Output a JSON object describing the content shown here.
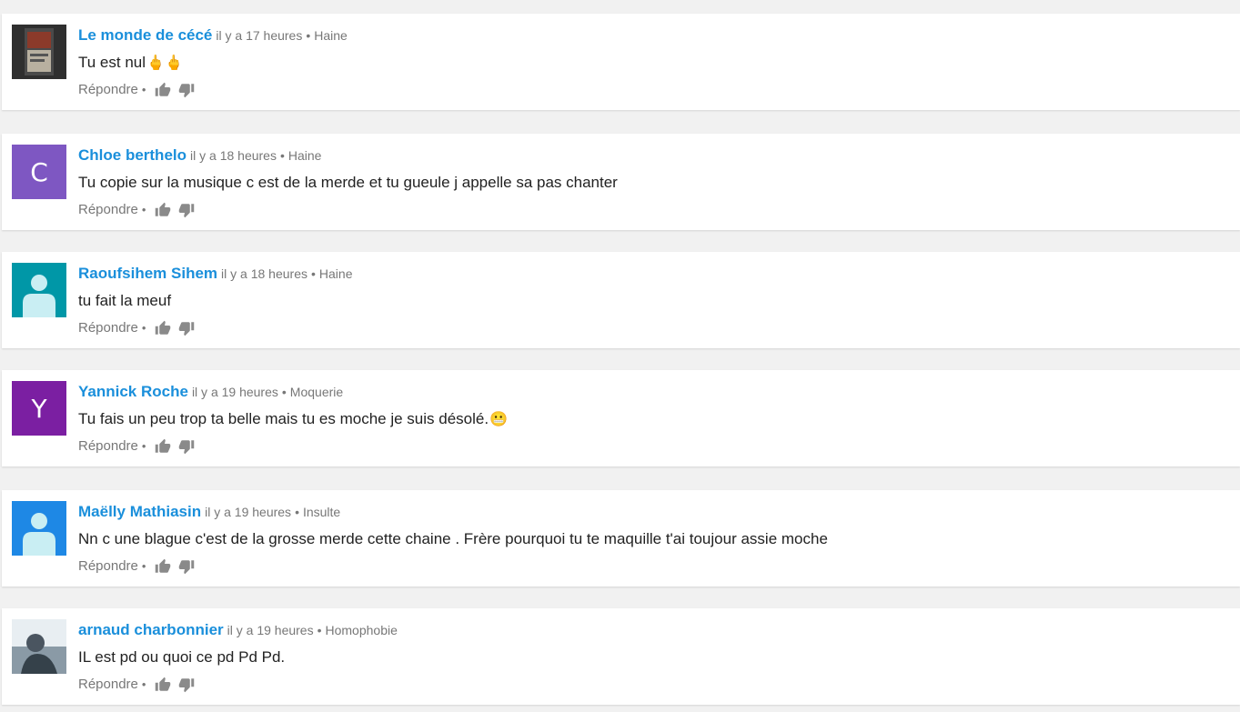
{
  "theme": {
    "author_color": "#1a8fdb",
    "meta_color": "#777777",
    "background": "#f1f1f1"
  },
  "comments": [
    {
      "author": "Le monde de cécé",
      "time": "il y a 17 heures",
      "category": "Haine",
      "text": "Tu est nul",
      "emoji": "🖕🖕",
      "reply": "Répondre",
      "avatar": {
        "type": "photo",
        "color": "#4a4a4a"
      }
    },
    {
      "author": "Chloe berthelo",
      "time": "il y a 18 heures",
      "category": "Haine",
      "text": "Tu copie sur la musique c est de la merde et tu gueule j appelle sa pas chanter",
      "emoji": "",
      "reply": "Répondre",
      "avatar": {
        "type": "letter",
        "letter": "C",
        "color": "#7e57c2"
      }
    },
    {
      "author": "Raoufsihem Sihem",
      "time": "il y a 18 heures",
      "category": "Haine",
      "text": "tu fait la meuf",
      "emoji": "",
      "reply": "Répondre",
      "avatar": {
        "type": "default",
        "color": "#0097a7"
      }
    },
    {
      "author": "Yannick Roche",
      "time": "il y a 19 heures",
      "category": "Moquerie",
      "text": "Tu fais un peu trop ta belle mais tu es moche je suis désolé.",
      "emoji": "😬",
      "reply": "Répondre",
      "avatar": {
        "type": "letter",
        "letter": "Y",
        "color": "#7b1fa2"
      }
    },
    {
      "author": "Maëlly Mathiasin",
      "time": "il y a 19 heures",
      "category": "Insulte",
      "text": "Nn c une blague c'est de la grosse merde cette chaine . Frère pourquoi tu te maquille t'ai toujour assie moche",
      "emoji": "",
      "reply": "Répondre",
      "avatar": {
        "type": "default",
        "color": "#1e88e5"
      }
    },
    {
      "author": "arnaud charbonnier",
      "time": "il y a 19 heures",
      "category": "Homophobie",
      "text": "IL est pd ou quoi ce pd Pd Pd.",
      "emoji": "",
      "reply": "Répondre",
      "avatar": {
        "type": "photo",
        "color": "#8a9aa6"
      }
    }
  ]
}
